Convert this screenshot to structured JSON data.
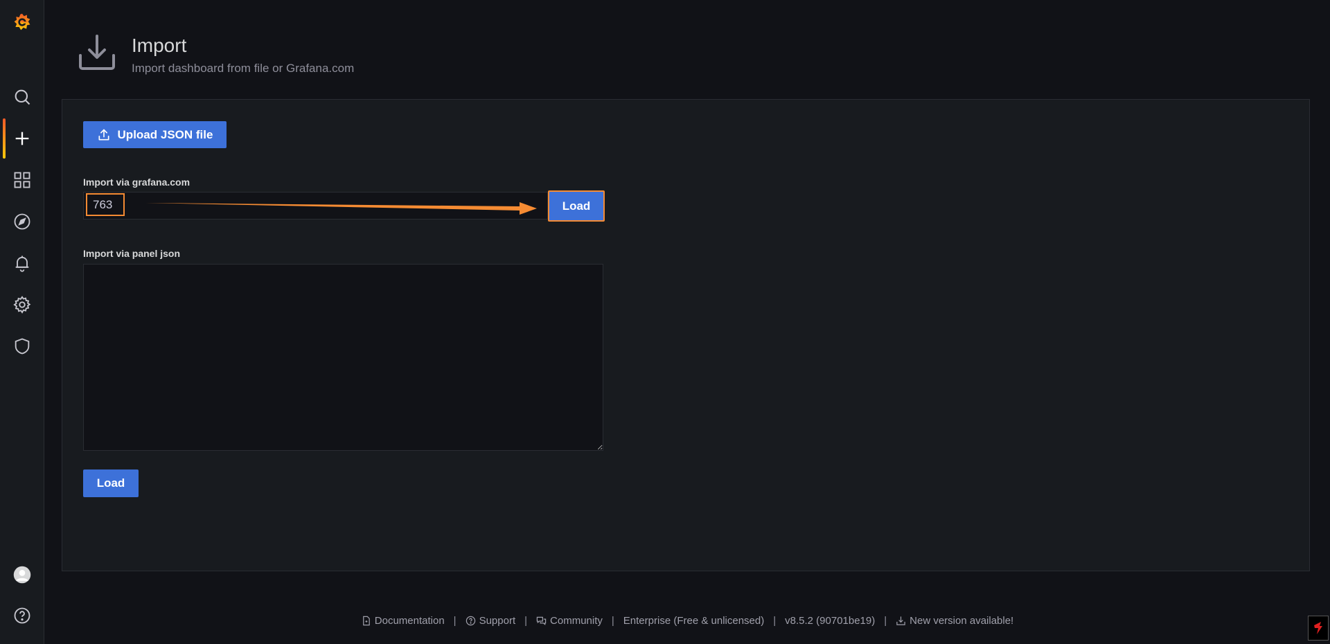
{
  "sidebar": {
    "items": [
      {
        "name": "search",
        "icon": "search-icon"
      },
      {
        "name": "create",
        "icon": "plus-icon",
        "active": true
      },
      {
        "name": "dashboards",
        "icon": "apps-icon"
      },
      {
        "name": "explore",
        "icon": "compass-icon"
      },
      {
        "name": "alerting",
        "icon": "bell-icon"
      },
      {
        "name": "configuration",
        "icon": "gear-icon"
      },
      {
        "name": "server-admin",
        "icon": "shield-icon"
      },
      {
        "name": "profile",
        "icon": "avatar-icon"
      },
      {
        "name": "help",
        "icon": "question-icon"
      }
    ]
  },
  "header": {
    "title": "Import",
    "subtitle": "Import dashboard from file or Grafana.com"
  },
  "main": {
    "upload_label": "Upload JSON file",
    "grafana_com_label": "Import via grafana.com",
    "grafana_com_value": "763",
    "grafana_com_placeholder": "",
    "load_label": "Load",
    "panel_json_label": "Import via panel json",
    "panel_json_value": "",
    "load_label_2": "Load"
  },
  "footer": {
    "documentation": "Documentation",
    "support": "Support",
    "community": "Community",
    "enterprise": "Enterprise (Free & unlicensed)",
    "version": "v8.5.2 (90701be19)",
    "new_version": "New version available!",
    "separator": "|"
  },
  "colors": {
    "background": "#111217",
    "panel": "#181b1f",
    "primary": "#3d71d9",
    "highlight": "#f58b33"
  }
}
